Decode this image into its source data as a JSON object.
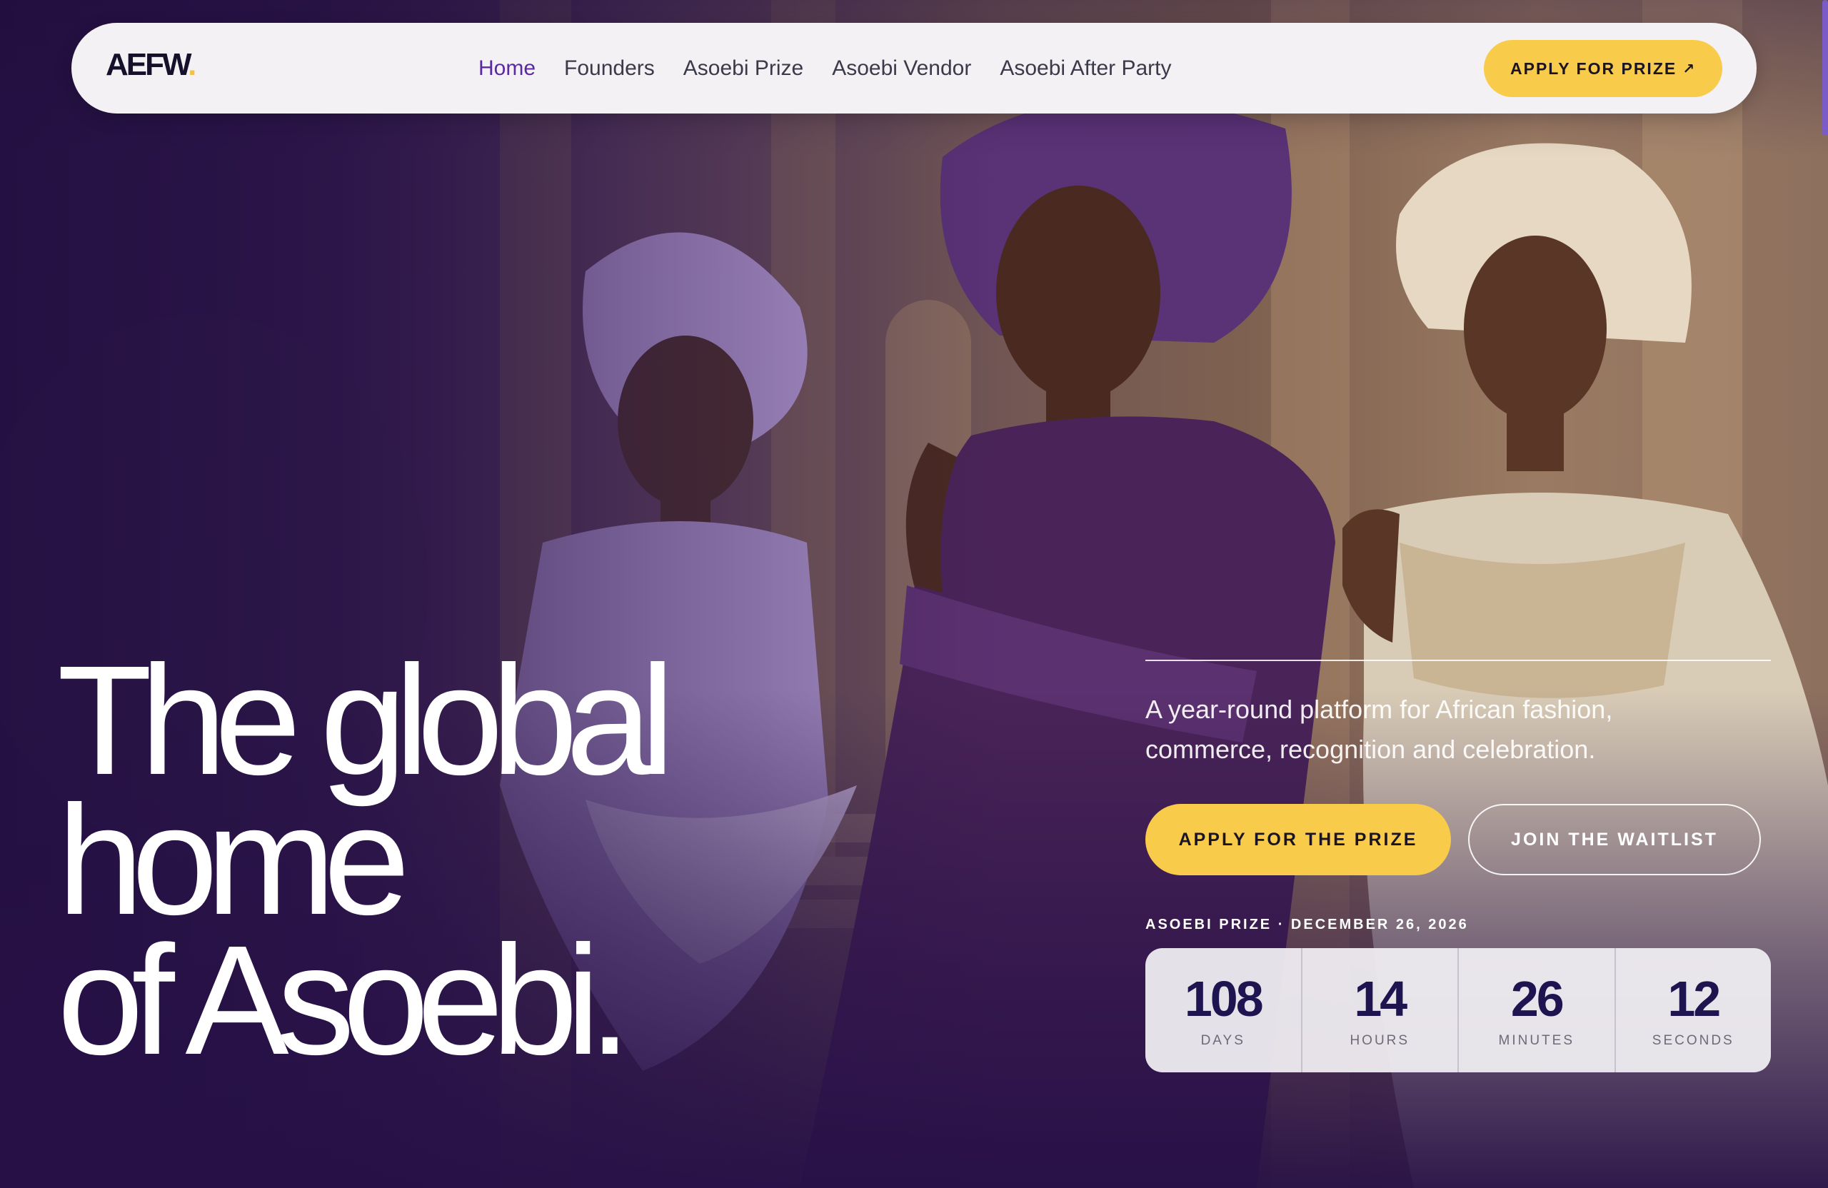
{
  "nav": {
    "logo": "AEFW",
    "logo_dot": ".",
    "links": [
      {
        "label": "Home"
      },
      {
        "label": "Founders"
      },
      {
        "label": "Asoebi Prize"
      },
      {
        "label": "Asoebi Vendor"
      },
      {
        "label": "Asoebi After Party"
      }
    ],
    "active_link": "Home",
    "cta_label": "APPLY FOR PRIZE",
    "cta_icon": "arrow-up-right-icon"
  },
  "hero": {
    "headline_lines": [
      "The global",
      "home",
      "of Asoebi."
    ],
    "tagline": "A year-round platform for African fashion, commerce, recognition and celebration.",
    "primary_button": "APPLY FOR THE PRIZE",
    "secondary_button": "JOIN THE WAITLIST",
    "event_label": "ASOEBI PRIZE · DECEMBER 26, 2026",
    "countdown": [
      {
        "value": "108",
        "unit": "DAYS"
      },
      {
        "value": "14",
        "unit": "HOURS"
      },
      {
        "value": "26",
        "unit": "MINUTES"
      },
      {
        "value": "12",
        "unit": "SECONDS"
      }
    ]
  },
  "colors": {
    "accent_yellow": "#f8cb4a",
    "brand_purple": "#5b2aa0",
    "hero_deep_purple": "#2a1746",
    "countdown_number": "#1e1450"
  }
}
